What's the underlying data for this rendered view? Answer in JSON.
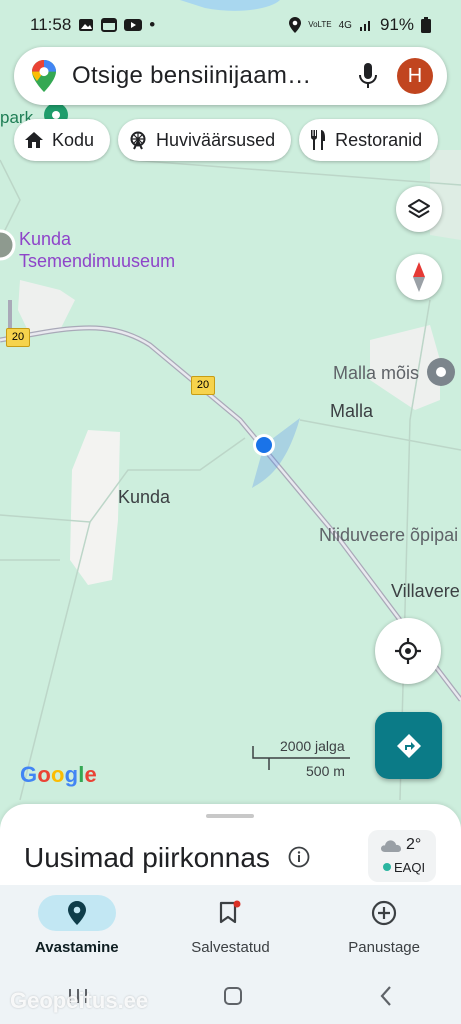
{
  "status_bar": {
    "time": "11:58",
    "dot": "•",
    "battery": "91%",
    "signal_text": "4G",
    "volte_text": "VoLTE"
  },
  "search": {
    "placeholder": "Otsige bensiinijaam…",
    "avatar_letter": "H"
  },
  "chips": [
    {
      "label": "Kodu",
      "icon": "home-icon"
    },
    {
      "label": "Huviväärsused",
      "icon": "ferris-wheel-icon"
    },
    {
      "label": "Restoranid",
      "icon": "restaurant-icon"
    }
  ],
  "map": {
    "labels": {
      "park": "park",
      "museum_line1": "Kunda",
      "museum_line2": "Tsemendimuuseum",
      "malla_mois": "Malla mõis",
      "malla": "Malla",
      "kunda": "Kunda",
      "niiduveere": "Niiduveere õpipai",
      "villavere": "Villavere"
    },
    "road_number": "20",
    "scale_imperial": "2000 jalga",
    "scale_metric": "500 m",
    "logo": "Google"
  },
  "bottom_sheet": {
    "title": "Uusimad piirkonnas",
    "weather_temp": "2°",
    "weather_aqi": "EAQI"
  },
  "nav": [
    {
      "label": "Avastamine",
      "icon": "explore-pin-icon",
      "active": true
    },
    {
      "label": "Salvestatud",
      "icon": "bookmark-icon",
      "active": false
    },
    {
      "label": "Panustage",
      "icon": "add-circle-icon",
      "active": false
    }
  ],
  "watermark": "Geopeitus.ee",
  "colors": {
    "map_bg": "#cdeedd",
    "accent": "#0b7b87",
    "location_dot": "#1a73e8",
    "museum_text": "#8e44c9",
    "avatar": "#c1451f"
  }
}
